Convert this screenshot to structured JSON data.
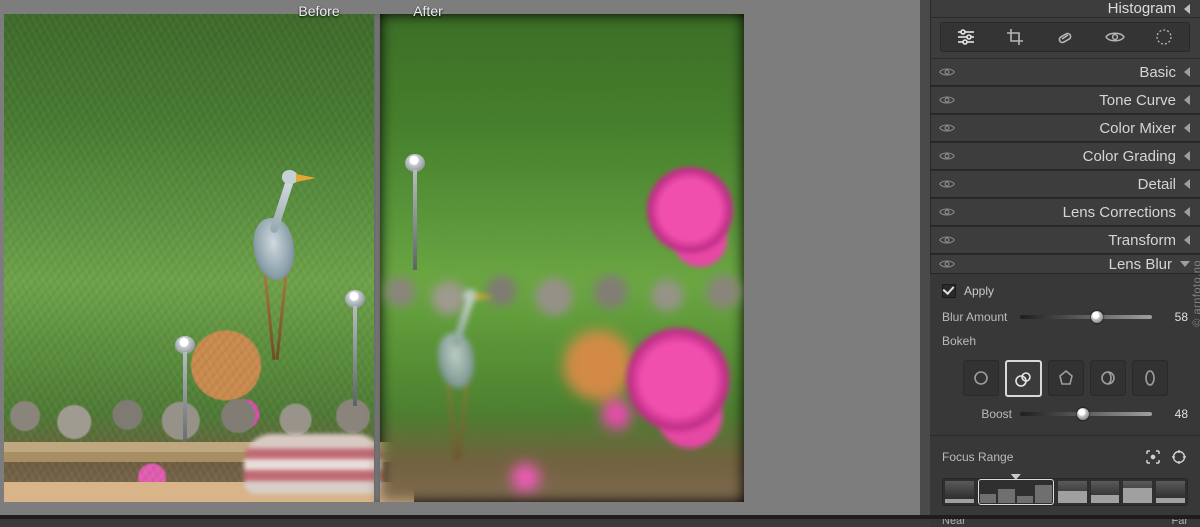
{
  "compare": {
    "before_label": "Before",
    "after_label": "After"
  },
  "watermark": "© arnfoto.no",
  "right_panel": {
    "header": "Histogram",
    "tools": [
      "edit-sliders-icon",
      "crop-icon",
      "healing-icon",
      "redeye-icon",
      "masking-icon"
    ],
    "sections": [
      {
        "title": "Basic"
      },
      {
        "title": "Tone Curve"
      },
      {
        "title": "Color Mixer"
      },
      {
        "title": "Color Grading"
      },
      {
        "title": "Detail"
      },
      {
        "title": "Lens Corrections"
      },
      {
        "title": "Transform"
      }
    ],
    "active_section": {
      "title": "Lens Blur",
      "apply_checked": true,
      "apply_label": "Apply",
      "blur_amount": {
        "label": "Blur Amount",
        "value": 58,
        "min": 0,
        "max": 100
      },
      "bokeh": {
        "label": "Bokeh",
        "options": [
          "circle",
          "ring",
          "blade5",
          "swirl",
          "anamorphic"
        ],
        "selected_index": 1
      },
      "boost": {
        "label": "Boost",
        "value": 48,
        "min": 0,
        "max": 100
      },
      "focus_range": {
        "label": "Focus Range",
        "near_label": "Near",
        "far_label": "Far"
      }
    }
  }
}
